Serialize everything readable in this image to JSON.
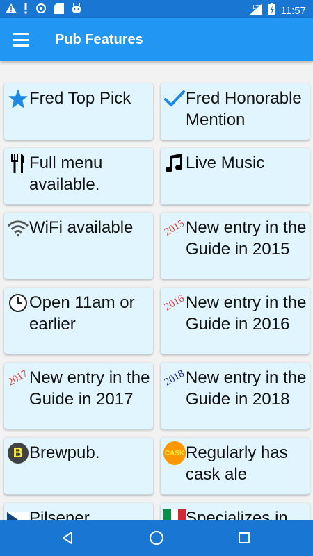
{
  "status_bar": {
    "time": "11:57",
    "network": "LTE",
    "icons": [
      "warning-icon",
      "alert-icon",
      "sync-icon",
      "sd-card-icon",
      "android-icon",
      "signal-icon",
      "battery-charging-icon"
    ]
  },
  "app_bar": {
    "title": "Pub Features",
    "menu_icon": "hamburger-menu-icon"
  },
  "features": [
    {
      "label": "Fred Top Pick",
      "icon": "star-icon"
    },
    {
      "label": "Fred Honorable Mention",
      "icon": "checkmark-icon"
    },
    {
      "label": "Full menu available.",
      "icon": "fork-knife-icon"
    },
    {
      "label": "Live Music",
      "icon": "music-note-icon"
    },
    {
      "label": "WiFi available",
      "icon": "wifi-icon"
    },
    {
      "label": "New entry in the Guide in 2015",
      "icon": "year-2015-icon",
      "icon_text": "2015"
    },
    {
      "label": "Open 11am or earlier",
      "icon": "clock-icon"
    },
    {
      "label": "New entry in the Guide in 2016",
      "icon": "year-2016-icon",
      "icon_text": "2016"
    },
    {
      "label": "New entry in the Guide in 2017",
      "icon": "year-2017-icon",
      "icon_text": "2017"
    },
    {
      "label": "New entry in the Guide in 2018",
      "icon": "year-2018-icon",
      "icon_text": "2018"
    },
    {
      "label": "Brewpub.",
      "icon": "brewpub-b-icon",
      "icon_text": "B"
    },
    {
      "label": "Regularly has cask ale",
      "icon": "cask-icon",
      "icon_text": "CASK"
    },
    {
      "label": "Pilsener",
      "icon": "czech-flag-icon"
    },
    {
      "label": "Specializes in",
      "icon": "italian-flag-icon"
    }
  ],
  "colors": {
    "status_bar": "#1976d2",
    "app_bar": "#2196f3",
    "card": "#e1f5fe",
    "year_2015": "#e53935",
    "year_2016": "#e53935",
    "year_2017": "#e53935",
    "year_2018": "#1a237e",
    "cask_badge": "#ff9800",
    "cask_text": "#ffeb3b",
    "brewpub_badge": "#424242",
    "brewpub_text": "#ffeb3b",
    "star": "#1e88e5",
    "check": "#1e88e5"
  },
  "nav_bar": {
    "icons": [
      "back-icon",
      "home-icon",
      "recents-icon"
    ]
  }
}
